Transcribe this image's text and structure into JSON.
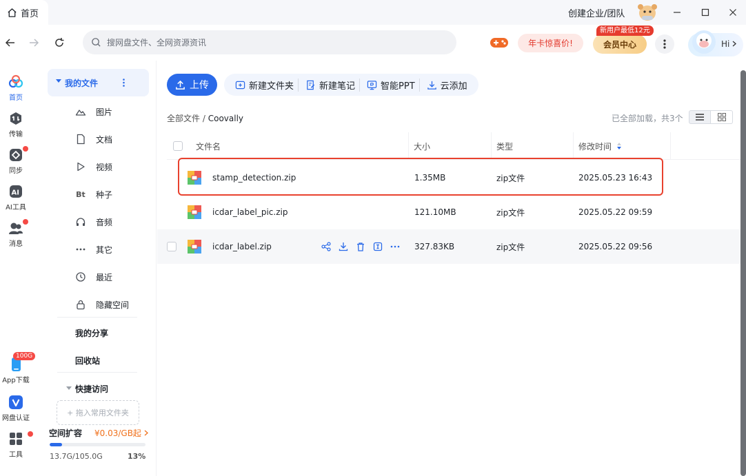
{
  "titlebar": {
    "home_tab": "首页",
    "create_team": "创建企业/团队"
  },
  "toolbar": {
    "search_placeholder": "搜网盘文件、全网资源资讯",
    "promo": "年卡惊喜价!",
    "vip_badge": "新用户最低12元",
    "vip_button": "会员中心",
    "greeting": "Hi"
  },
  "rail": {
    "items": [
      {
        "label": "首页",
        "icon": "cloud-logo-icon"
      },
      {
        "label": "传输",
        "icon": "transfer-icon"
      },
      {
        "label": "同步",
        "icon": "sync-icon"
      },
      {
        "label": "AI工具",
        "icon": "ai-icon"
      },
      {
        "label": "消息",
        "icon": "message-icon"
      },
      {
        "label": "App下载",
        "icon": "phone-icon",
        "badge": "100G"
      },
      {
        "label": "网盘认证",
        "icon": "verify-icon"
      },
      {
        "label": "工具",
        "icon": "tools-icon"
      }
    ]
  },
  "sidenav": {
    "my_files": "我的文件",
    "categories": [
      "图片",
      "文档",
      "视频",
      "种子",
      "音频",
      "其它",
      "最近",
      "隐藏空间"
    ],
    "torrent_glyph": "Bt",
    "my_share": "我的分享",
    "recycle": "回收站",
    "quick_access": "快捷访问",
    "drop_hint": "+ 拖入常用文件夹",
    "expand_title": "空间扩容",
    "expand_price": "¥0.03/GB起",
    "storage_used": "13.7G/105.0G",
    "storage_percent": "13%",
    "storage_fraction": 0.13
  },
  "main": {
    "upload": "上传",
    "actions": [
      "新建文件夹",
      "新建笔记",
      "智能PPT",
      "云添加"
    ],
    "breadcrumb_root": "全部文件",
    "breadcrumb_sep": "/",
    "breadcrumb_current": "Coovally",
    "loaded_status": "已全部加载，共3个",
    "columns": [
      "文件名",
      "大小",
      "类型",
      "修改时间"
    ],
    "files": [
      {
        "name": "stamp_detection.zip",
        "size": "1.35MB",
        "type": "zip文件",
        "modified": "2025.05.23 16:43"
      },
      {
        "name": "icdar_label_pic.zip",
        "size": "121.10MB",
        "type": "zip文件",
        "modified": "2025.05.22 09:59"
      },
      {
        "name": "icdar_label.zip",
        "size": "327.83KB",
        "type": "zip文件",
        "modified": "2025.05.22 09:56"
      }
    ]
  },
  "colors": {
    "accent": "#2a6ae9",
    "highlight": "#e8412e",
    "promo_red": "#e2372b",
    "price_orange": "#f0711c"
  }
}
